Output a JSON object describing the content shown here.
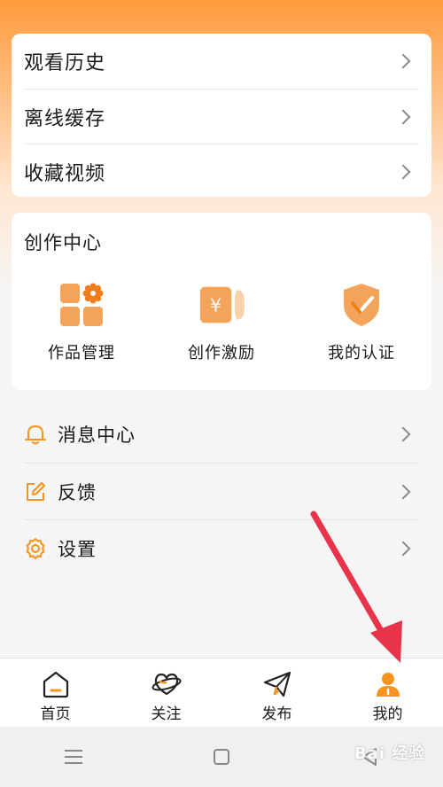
{
  "list_menu": {
    "items": [
      {
        "label": "观看历史"
      },
      {
        "label": "离线缓存"
      },
      {
        "label": "收藏视频"
      }
    ]
  },
  "creator_center": {
    "title": "创作中心",
    "items": [
      {
        "label": "作品管理",
        "icon": "grid-icon"
      },
      {
        "label": "创作激励",
        "icon": "yuan-card-icon"
      },
      {
        "label": "我的认证",
        "icon": "shield-check-icon"
      }
    ]
  },
  "settings_menu": {
    "items": [
      {
        "label": "消息中心",
        "icon": "bell-icon"
      },
      {
        "label": "反馈",
        "icon": "edit-icon"
      },
      {
        "label": "设置",
        "icon": "gear-icon"
      }
    ]
  },
  "tabbar": {
    "tabs": [
      {
        "label": "首页",
        "icon": "home-icon"
      },
      {
        "label": "关注",
        "icon": "heart-planet-icon"
      },
      {
        "label": "发布",
        "icon": "paper-plane-icon"
      },
      {
        "label": "我的",
        "icon": "user-icon",
        "active": true
      }
    ]
  },
  "system_nav": {
    "buttons": [
      "menu-icon",
      "home-square-icon",
      "back-triangle-icon"
    ]
  },
  "watermark": {
    "text": "Bai 经验"
  },
  "colors": {
    "accent": "#f7931e",
    "arrow": "#e8344a",
    "header_gradient_top": "#ff9a3c"
  }
}
